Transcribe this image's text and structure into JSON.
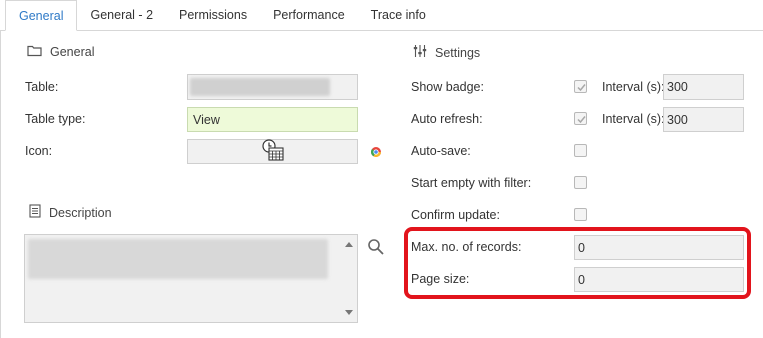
{
  "tabs": [
    {
      "label": "General",
      "active": true
    },
    {
      "label": "General - 2",
      "active": false
    },
    {
      "label": "Permissions",
      "active": false
    },
    {
      "label": "Performance",
      "active": false
    },
    {
      "label": "Trace info",
      "active": false
    }
  ],
  "general": {
    "title": "General",
    "icon": "folder-icon",
    "table_label": "Table:",
    "table_value": "",
    "table_type_label": "Table type:",
    "table_type_value": "View",
    "icon_label": "Icon:",
    "icon_value_icon": "clock-calendar-icon",
    "icon_side_icon": "browser-icon"
  },
  "description": {
    "title": "Description",
    "icon": "document-icon",
    "value": "",
    "search_icon": "search-icon"
  },
  "settings": {
    "title": "Settings",
    "icon": "sliders-icon",
    "show_badge_label": "Show badge:",
    "show_badge_checked": true,
    "show_badge_interval_label": "Interval (s):",
    "show_badge_interval_value": "300",
    "auto_refresh_label": "Auto refresh:",
    "auto_refresh_checked": true,
    "auto_refresh_interval_label": "Interval (s):",
    "auto_refresh_interval_value": "300",
    "auto_save_label": "Auto-save:",
    "auto_save_checked": false,
    "start_empty_label": "Start empty with filter:",
    "start_empty_checked": false,
    "confirm_update_label": "Confirm update:",
    "confirm_update_checked": false,
    "max_records_label": "Max. no. of records:",
    "max_records_value": "0",
    "page_size_label": "Page size:",
    "page_size_value": "0"
  },
  "colors": {
    "accent": "#2f7ac7",
    "highlight": "#e2141c",
    "table_type_bg": "#eefad9"
  }
}
